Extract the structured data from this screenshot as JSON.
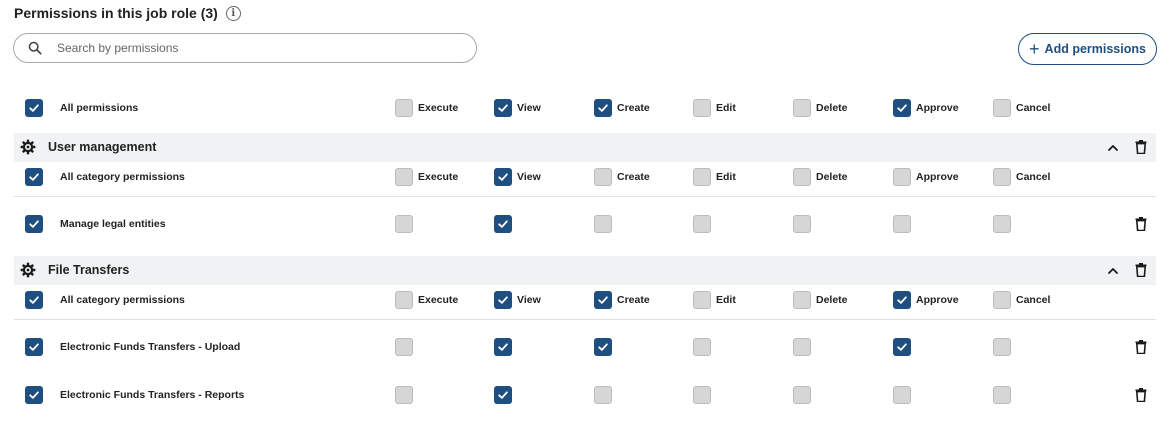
{
  "header": {
    "title": "Permissions in this job role (3)",
    "info_glyph": "i"
  },
  "search": {
    "placeholder": "Search by permissions"
  },
  "add_button": {
    "label": "Add permissions",
    "plus": "+"
  },
  "colors": {
    "accent": "#1e4f80",
    "unchecked": "#d6d6d6",
    "band": "#f1f2f3"
  },
  "permission_columns": [
    "Execute",
    "View",
    "Create",
    "Edit",
    "Delete",
    "Approve",
    "Cancel"
  ],
  "all_permissions": {
    "label": "All permissions",
    "checked": true,
    "values": [
      false,
      true,
      true,
      false,
      false,
      true,
      false
    ]
  },
  "categories": [
    {
      "name": "User management",
      "all_label": "All category permissions",
      "all_checked": true,
      "all_values": [
        false,
        true,
        false,
        false,
        false,
        false,
        false
      ],
      "items": [
        {
          "label": "Manage legal entities",
          "checked": true,
          "values": [
            false,
            true,
            false,
            false,
            false,
            false,
            false
          ]
        }
      ]
    },
    {
      "name": "File Transfers",
      "all_label": "All category permissions",
      "all_checked": true,
      "all_values": [
        false,
        true,
        true,
        false,
        false,
        true,
        false
      ],
      "items": [
        {
          "label": "Electronic Funds Transfers - Upload",
          "checked": true,
          "values": [
            false,
            true,
            true,
            false,
            false,
            true,
            false
          ]
        },
        {
          "label": "Electronic Funds Transfers - Reports",
          "checked": true,
          "values": [
            false,
            true,
            false,
            false,
            false,
            false,
            false
          ]
        }
      ]
    }
  ]
}
